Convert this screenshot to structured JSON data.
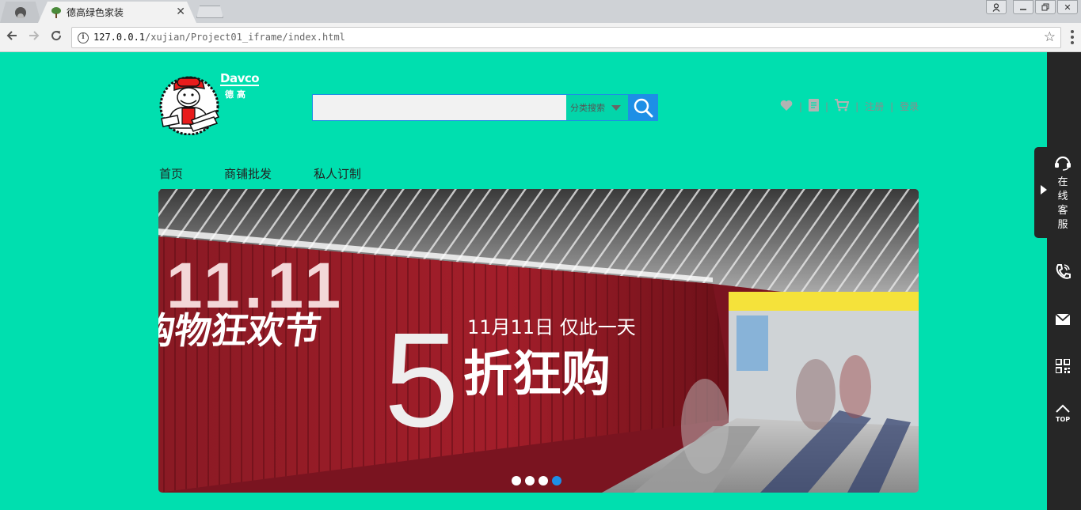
{
  "browser": {
    "tab_title": "德高绿色家装",
    "url_host": "127.0.0.1",
    "url_path": "/xujian/Project01_iframe/index.html"
  },
  "brand": {
    "en": "Davco",
    "cn": "德高"
  },
  "search": {
    "value": "",
    "category_label": "分类搜索"
  },
  "user_links": {
    "register": "注册",
    "login": "登录"
  },
  "nav": [
    "首页",
    "商铺批发",
    "私人订制"
  ],
  "banner": {
    "headline_1111": "11.11",
    "festival": "购物狂欢节",
    "date_text": "11月11日 仅此一天",
    "big_number": "5",
    "sale_text": "折狂购",
    "slide_count": 4,
    "active_slide": 4
  },
  "sidebar": {
    "service_text": "在线客服",
    "top_label": "TOP"
  },
  "colors": {
    "page_bg": "#00dfaf",
    "accent_blue": "#1d8fe6",
    "sidebar_bg": "#262626"
  }
}
